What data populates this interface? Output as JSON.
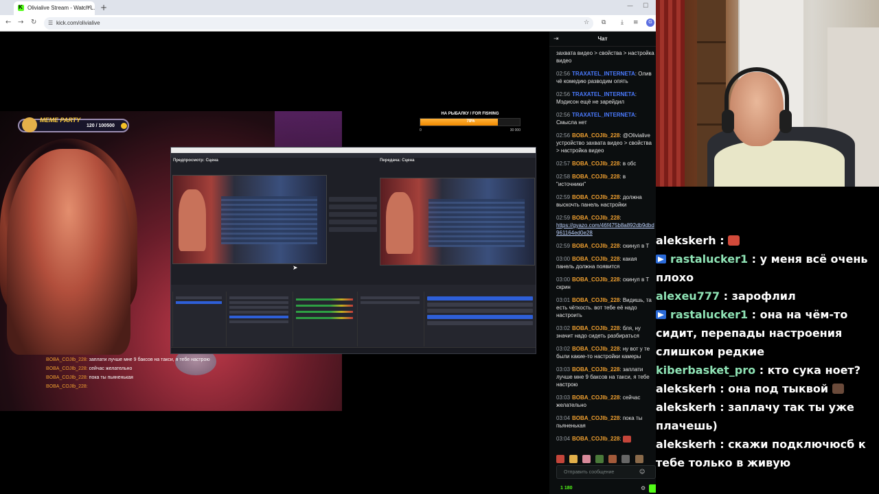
{
  "browser": {
    "tab_title": "Olivialive Stream - Watch L...",
    "url": "kick.com/olivialive",
    "profile_initial": "G"
  },
  "stream": {
    "meme_party": {
      "title": "MEME PARTY",
      "count": "120 / 100500"
    },
    "fishing_goal": {
      "title": "НА РЫБАЛКУ / FOR FISHING",
      "percent_label": "78%",
      "progress_fraction": 0.78,
      "min": "0",
      "max": "30 000"
    },
    "obs": {
      "preview_label": "Предпросмотр: Сцена",
      "program_label": "Передача: Сцена"
    },
    "overlay_chat": [
      {
        "user": "BOBA_COJIb_228:",
        "text": " заплати лучше мне 9 баксов на такси, я тебе настрою"
      },
      {
        "user": "BOBA_COJIb_228:",
        "text": " сейчас желательно"
      },
      {
        "user": "BOBA_COJIb_228:",
        "text": " пока ты пьяненькая"
      },
      {
        "user": "BOBA_COJIb_228:",
        "text": ""
      }
    ]
  },
  "chat": {
    "header_title": "Чат",
    "messages": [
      {
        "time": "",
        "user": "",
        "user_color": "#e6e6e6",
        "text": "захвата видео > свойства > настройка видео"
      },
      {
        "time": "02:56",
        "user": "TRAXATEL_INTERNETA",
        "user_color": "#4b7bff",
        "text": "Олив чё комедию разводим опять"
      },
      {
        "time": "02:56",
        "user": "TRAXATEL_INTERNETA",
        "user_color": "#4b7bff",
        "text": "Мэдисон ещё не зарейдил"
      },
      {
        "time": "02:56",
        "user": "TRAXATEL_INTERNETA",
        "user_color": "#4b7bff",
        "text": "Смысла нет"
      },
      {
        "time": "02:56",
        "user": "BOBA_COJIb_228",
        "user_color": "#f0a030",
        "text": "@Olivialive устройство захвата видео > свойства > настройка видео"
      },
      {
        "time": "02:57",
        "user": "BOBA_COJIb_228",
        "user_color": "#f0a030",
        "text": "в обс"
      },
      {
        "time": "02:58",
        "user": "BOBA_COJIb_228",
        "user_color": "#f0a030",
        "text": "в \"источники\""
      },
      {
        "time": "02:59",
        "user": "BOBA_COJIb_228",
        "user_color": "#f0a030",
        "text": "должна выскочть панель настройки"
      },
      {
        "time": "02:59",
        "user": "BOBA_COJIb_228",
        "user_color": "#f0a030",
        "text": "",
        "link": "https://gyazo.com/46f475b8a892db9dbd961164ed0e28"
      },
      {
        "time": "02:59",
        "user": "BOBA_COJIb_228",
        "user_color": "#f0a030",
        "text": "скинул в Т"
      },
      {
        "time": "03:00",
        "user": "BOBA_COJIb_228",
        "user_color": "#f0a030",
        "text": "какая панель должна появится"
      },
      {
        "time": "03:00",
        "user": "BOBA_COJIb_228",
        "user_color": "#f0a030",
        "text": "скинул в Т скрин"
      },
      {
        "time": "03:01",
        "user": "BOBA_COJIb_228",
        "user_color": "#f0a030",
        "text": "Видишь, та есть чёткость. вот тебе её надо настроить"
      },
      {
        "time": "03:02",
        "user": "BOBA_COJIb_228",
        "user_color": "#f0a030",
        "text": "бля, ну значит надо сидеть разбираться"
      },
      {
        "time": "03:02",
        "user": "BOBA_COJIb_228",
        "user_color": "#f0a030",
        "text": "ну вот у те были какие-то настройки камеры"
      },
      {
        "time": "03:03",
        "user": "BOBA_COJIb_228",
        "user_color": "#f0a030",
        "text": "заплати лучше мне 9 баксов на такси, я тебе настрою"
      },
      {
        "time": "03:03",
        "user": "BOBA_COJIb_228",
        "user_color": "#f0a030",
        "text": "сейчас желательно"
      },
      {
        "time": "03:04",
        "user": "BOBA_COJIb_228",
        "user_color": "#f0a030",
        "text": "пока ты пьяненькая"
      },
      {
        "time": "03:04",
        "user": "BOBA_COJIb_228",
        "user_color": "#f0a030",
        "text": "",
        "emote": "#c4453a"
      }
    ],
    "input_placeholder": "Отправить сообщение",
    "points": "1 180"
  },
  "big_chat": [
    {
      "badge": false,
      "user": "alekskerh",
      "user_color": "#ffffff",
      "text": " : ",
      "emote": "#d24a3a"
    },
    {
      "badge": true,
      "user": "rastalucker1",
      "user_color": "#8fe3b5",
      "text": " : у меня всё очень плохо"
    },
    {
      "badge": false,
      "user": "alexeu777",
      "user_color": "#8fe3b5",
      "text": " : зарофлил"
    },
    {
      "badge": true,
      "user": "rastalucker1",
      "user_color": "#8fe3b5",
      "text": " : она на чём-то сидит, перепады настроения слишком редкие"
    },
    {
      "badge": false,
      "user": "kiberbasket_pro",
      "user_color": "#8fe3b5",
      "text": " : кто сука ноет?"
    },
    {
      "badge": false,
      "user": "alekskerh",
      "user_color": "#ffffff",
      "text": " : она под тыквой ",
      "emote": "#6a4a3a"
    },
    {
      "badge": false,
      "user": "alekskerh",
      "user_color": "#ffffff",
      "text": " : заплачу так ты уже плачешь)"
    },
    {
      "badge": false,
      "user": "alekskerh",
      "user_color": "#ffffff",
      "text": " : скажи подключюсб к тебе только в живую"
    }
  ]
}
